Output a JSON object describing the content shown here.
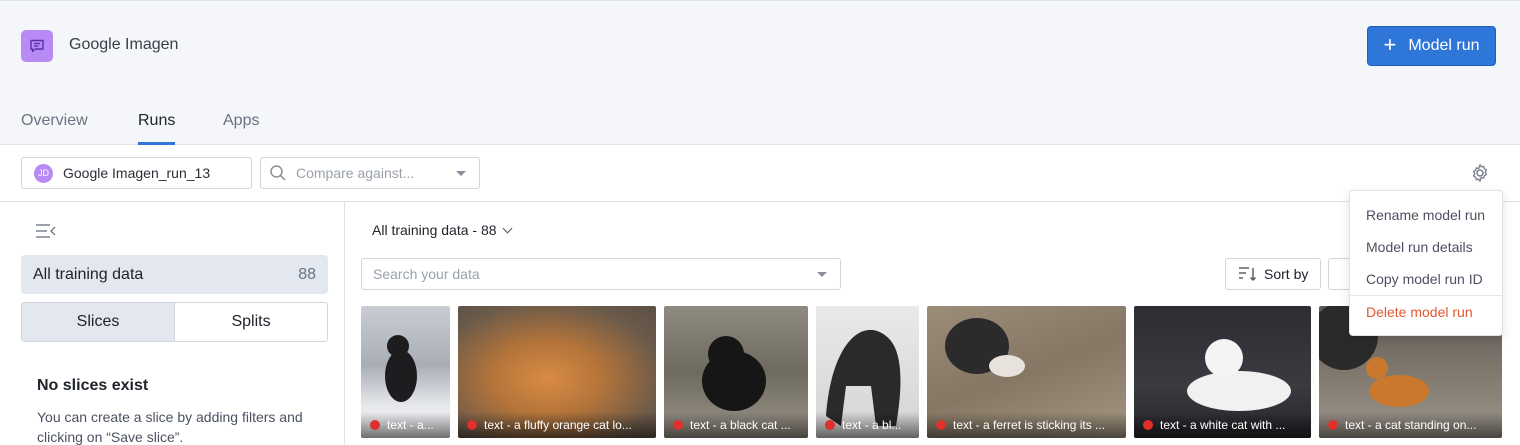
{
  "app": {
    "title": "Google Imagen",
    "icon": "chat-bubble-icon"
  },
  "actions": {
    "model_run_label": "Model run"
  },
  "tabs": [
    {
      "label": "Overview"
    },
    {
      "label": "Runs",
      "active": true
    },
    {
      "label": "Apps"
    }
  ],
  "toolbar": {
    "run": {
      "avatar": "JD",
      "name": "Google Imagen_run_13"
    },
    "compare_placeholder": "Compare against..."
  },
  "sidebar": {
    "all_training_label": "All training data",
    "all_training_count": "88",
    "segments": [
      "Slices",
      "Splits"
    ],
    "empty_title": "No slices exist",
    "empty_desc": "You can create a slice by adding filters and clicking on “Save slice”."
  },
  "main": {
    "dataset_label": "All training data - 88",
    "search_placeholder": "Search your data",
    "sort_label": "Sort by"
  },
  "thumbnails": [
    {
      "caption": "text - a...",
      "bg": "#8f95a0"
    },
    {
      "caption": "text - a fluffy orange cat lo...",
      "bg": "#b5743a"
    },
    {
      "caption": "text - a black cat ...",
      "bg": "#6e6a5e"
    },
    {
      "caption": "text - a bl...",
      "bg": "#7a7a7a"
    },
    {
      "caption": "text - a ferret is sticking its ...",
      "bg": "#857764"
    },
    {
      "caption": "text - a white cat with ...",
      "bg": "#3b3a40"
    },
    {
      "caption": "text - a cat standing on...",
      "bg": "#7d756a"
    }
  ],
  "menu": {
    "items": [
      "Rename model run",
      "Model run details",
      "Copy model run ID"
    ],
    "danger_item": "Delete model run"
  },
  "colors": {
    "accent": "#2f76d9",
    "danger": "#e4572e",
    "status_dot": "#e0302c",
    "brand_icon": "#b88af5"
  }
}
